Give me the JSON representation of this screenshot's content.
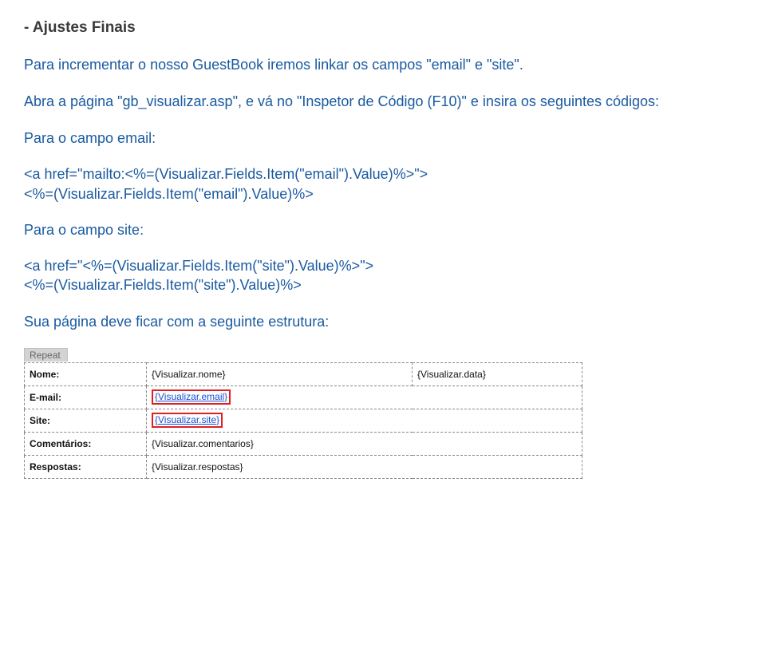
{
  "heading": "- Ajustes Finais",
  "intro1": "Para incrementar o nosso GuestBook iremos linkar os campos \"email\" e \"site\".",
  "intro2a": "Abra a página \"gb_visualizar.asp\", e vá no \"Inspetor de Código (F10)\" e insira os seguintes códigos:",
  "label_email": "Para o campo email:",
  "code_email_line1": "<a href=\"mailto:<%=(Visualizar.Fields.Item(\"email\").Value)%>\">",
  "code_email_line2": "<%=(Visualizar.Fields.Item(\"email\").Value)%>",
  "label_site": "Para o campo site:",
  "code_site_line1": "<a href=\"<%=(Visualizar.Fields.Item(\"site\").Value)%>\">",
  "code_site_line2": "<%=(Visualizar.Fields.Item(\"site\").Value)%>",
  "closing": "Sua página deve ficar com a seguinte estrutura:",
  "preview": {
    "repeat_tab": "Repeat",
    "rows": {
      "nome_label": "Nome:",
      "nome_value": "{Visualizar.nome}",
      "data_value": "{Visualizar.data}",
      "email_label": "E-mail:",
      "email_value": "{Visualizar.email}",
      "site_label": "Site:",
      "site_value": "{Visualizar.site}",
      "coment_label": "Comentários:",
      "coment_value": "{Visualizar.comentarios}",
      "resp_label": "Respostas:",
      "resp_value": "{Visualizar.respostas}"
    }
  }
}
